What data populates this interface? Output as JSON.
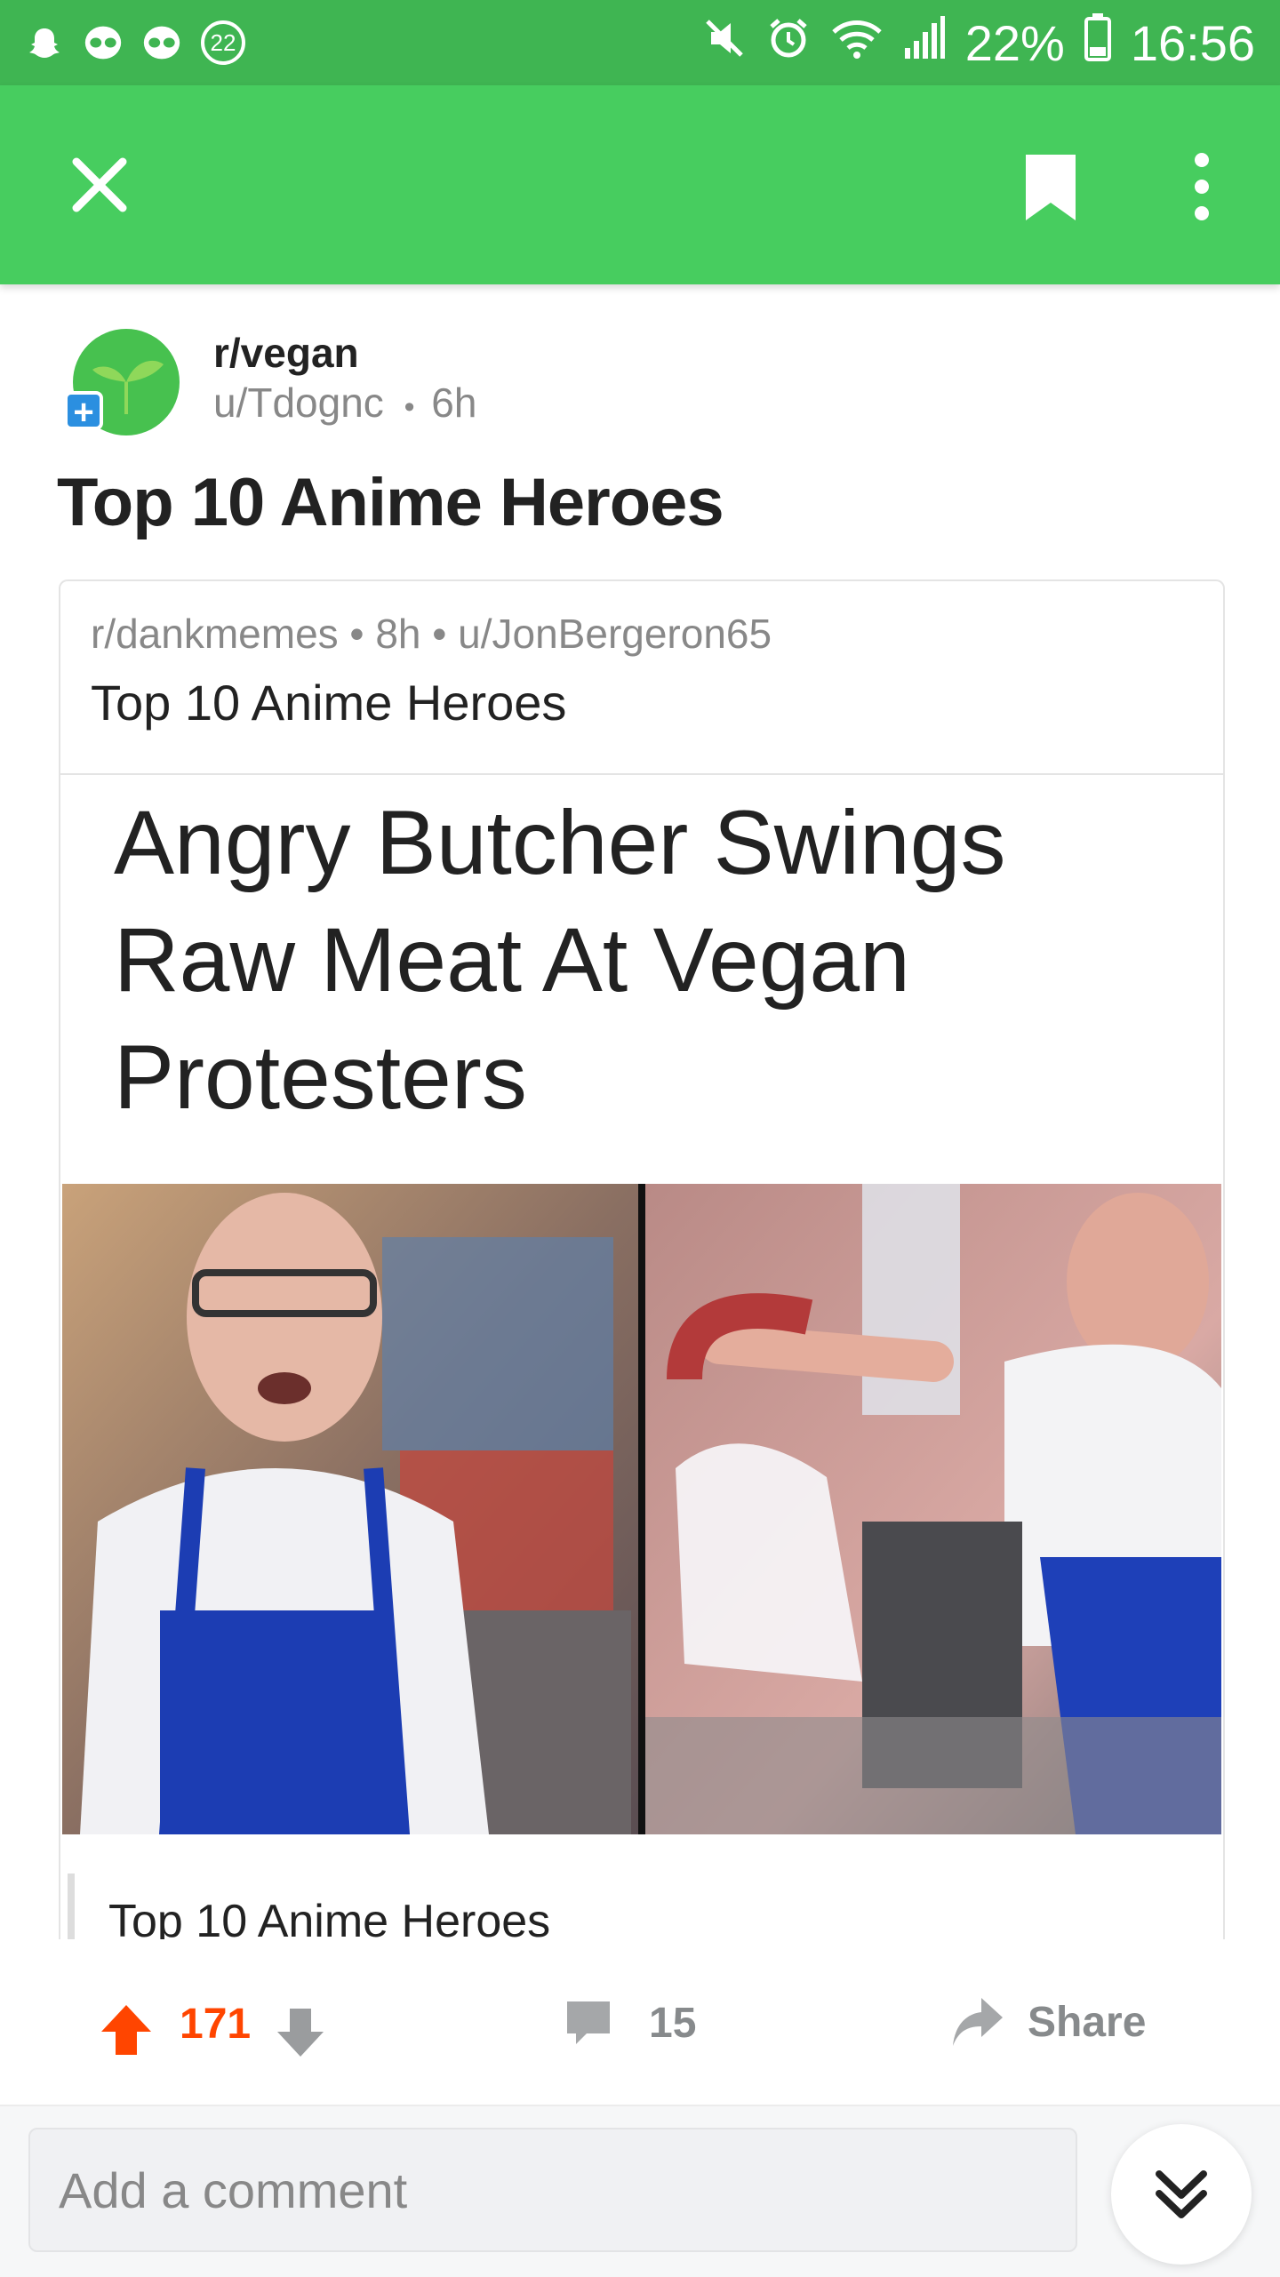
{
  "status_bar": {
    "notification_count": "22",
    "battery": "22%",
    "time": "16:56",
    "icons": [
      "snapchat-icon",
      "alien-icon",
      "alien-icon",
      "mute-icon",
      "alarm-icon",
      "wifi-icon",
      "signal-icon",
      "battery-icon"
    ]
  },
  "app_bar": {
    "close_icon": "close-icon",
    "bookmark_icon": "bookmark-icon",
    "more_icon": "more-vertical-icon",
    "color": "#47cd5f"
  },
  "post": {
    "subreddit": "r/vegan",
    "author": "u/Tdognc",
    "separator": "•",
    "age": "6h",
    "title": "Top 10 Anime Heroes"
  },
  "crosspost": {
    "meta": "r/dankmemes • 8h • u/JonBergeron65",
    "title": "Top 10 Anime Heroes",
    "headline": "Angry Butcher Swings Raw Meat At Vegan Protesters",
    "caption": "Top 10 Anime Heroes"
  },
  "actions": {
    "score": "171",
    "comments": "15",
    "share": "Share",
    "upvote_color": "#ff4500"
  },
  "comment_bar": {
    "placeholder": "Add a comment"
  }
}
